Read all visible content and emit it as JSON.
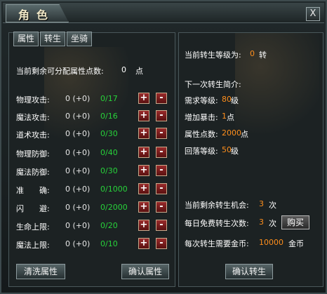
{
  "window": {
    "title": "角色",
    "close_symbol": "X"
  },
  "tabs": [
    "属性",
    "转生",
    "坐骑"
  ],
  "left": {
    "remaining_label": "当前剩余可分配属性点数:",
    "remaining_value": "0",
    "remaining_unit": "点",
    "attributes": [
      {
        "label": "物理攻击:",
        "value": "0 (+0)",
        "progress": "0/17"
      },
      {
        "label": "魔法攻击:",
        "value": "0 (+0)",
        "progress": "0/16"
      },
      {
        "label": "道术攻击:",
        "value": "0 (+0)",
        "progress": "0/30"
      },
      {
        "label": "物理防御:",
        "value": "0 (+0)",
        "progress": "0/40"
      },
      {
        "label": "魔法防御:",
        "value": "0 (+0)",
        "progress": "0/30"
      },
      {
        "label": "准　　确:",
        "value": "0 (+0)",
        "progress": "0/1000"
      },
      {
        "label": "闪　　避:",
        "value": "0 (+0)",
        "progress": "0/2000"
      },
      {
        "label": "生命上限:",
        "value": "0 (+0)",
        "progress": "0/20"
      },
      {
        "label": "魔法上限:",
        "value": "0 (+0)",
        "progress": "0/10"
      }
    ],
    "plus_symbol": "+",
    "minus_symbol": "-",
    "clear_button": "清洗属性",
    "confirm_button": "确认属性"
  },
  "right": {
    "level_label": "当前转生等级为:",
    "level_value": "0",
    "level_unit": "转",
    "next_title": "下一次转生简介:",
    "req_level_label": "需求等级:",
    "req_level_value": "80",
    "req_level_unit": "级",
    "crit_label": "增加暴击:",
    "crit_value": "1",
    "crit_unit": "点",
    "points_label": "属性点数:",
    "points_value": "2000",
    "points_unit": "点",
    "drop_label": "回落等级:",
    "drop_value": "50",
    "drop_unit": "级",
    "chances_label": "当前剩余转生机会:",
    "chances_value": "3",
    "chances_unit": "次",
    "free_label": "每日免费转生次数:",
    "free_value": "3",
    "free_unit": "次",
    "buy_button": "购买",
    "gold_label": "每次转生需要金币:",
    "gold_value": "10000",
    "gold_unit": "金币",
    "confirm_button": "确认转生"
  }
}
